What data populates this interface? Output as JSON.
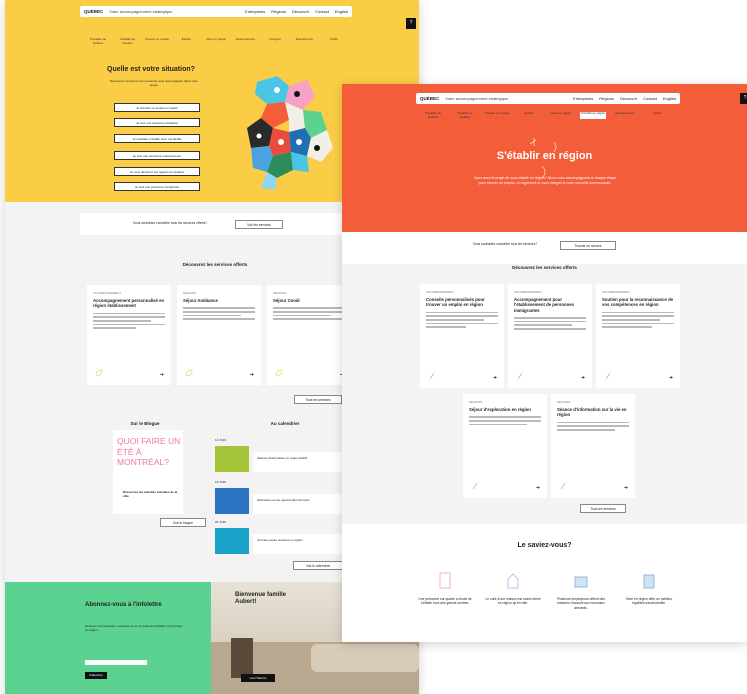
{
  "colors": {
    "yellow": "#fbcd47",
    "red": "#f45d3a",
    "green": "#5bd28f",
    "page_bg": "#f4f2f3",
    "teal": "#1aa3c9",
    "lime": "#a6c43a",
    "blue": "#2d73c4"
  },
  "page1": {
    "nav": {
      "logo": "QUÉBEC",
      "search": "Votre accompagnement stratégique",
      "links": [
        "Entreprises",
        "Régions",
        "Découvrir",
        "Contact",
        "English"
      ],
      "menu_icon": "?"
    },
    "menu": [
      "Travailler au Québec",
      "S'établir au Québec",
      "Trouver un emploi",
      "Étudier",
      "Vivre en région",
      "Entrepreneurs",
      "Immigrer",
      "Événements",
      "Outils"
    ],
    "hero_title": "Quelle est votre situation?",
    "hero_sub": "Découvrez comment nous pouvons vous accompagner dans votre projet.",
    "options": [
      "Je cherche un emploi en région",
      "Je suis une personne étudiante",
      "Je souhaite m'établir avec ma famille",
      "Je suis une personne entrepreneure",
      "Je veux découvrir les régions du Québec",
      "Je suis une personne immigrante"
    ],
    "strip_text": "Vous souhaitez connaître tous les services offerts?",
    "strip_btn": "Voir les services",
    "services_title": "Découvrez les services offerts",
    "cards": [
      {
        "cat": "ACCOMPAGNEMENT",
        "title": "Accompagnement personnalisé en région établissement"
      },
      {
        "cat": "SÉJOURS",
        "title": "Séjour Ambiance"
      },
      {
        "cat": "SÉJOURS",
        "title": "Séjour Coodi"
      }
    ],
    "all_services_btn": "Tous les services",
    "blog_title": "Sur le Blogue",
    "blog_art": "QUOI FAIRE UN ÉTÉ À MONTRÉAL?",
    "blog_caption": "Découvrez les activités estivales de la ville",
    "blog_btn": "Voir le blogue",
    "calendar_title": "Au calendrier",
    "events": [
      {
        "date": "12 JUIN",
        "text": "Séance d'information en région Abitibi"
      },
      {
        "date": "19 JUIN",
        "text": "Webinaire sur les opportunités d'emploi"
      },
      {
        "date": "26 JUIN",
        "text": "Journée portes ouvertes en région"
      }
    ],
    "calendar_btn": "Voir le calendrier",
    "newsletter_title": "Abonnez-vous à l'infolettre",
    "newsletter_text": "Recevez nos nouvelles, événements et conseils pour faciliter votre projet en région.",
    "newsletter_btn": "S'abonner",
    "photo_title": "Bienvenue famille Aubert!",
    "photo_btn": "Lire l'histoire"
  },
  "page2": {
    "nav": {
      "logo": "QUÉBEC",
      "search": "Votre accompagnement stratégique",
      "links": [
        "Entreprises",
        "Régions",
        "Découvrir",
        "Contact",
        "English"
      ],
      "menu_icon": "?"
    },
    "menu": [
      "Travailler au Québec",
      "S'établir au Québec",
      "Trouver un emploi",
      "Étudier",
      "Vivre en région",
      "S'établir en région",
      "Entrepreneurs",
      "Outils"
    ],
    "hero_title": "S'établir en région",
    "hero_text": "Vous avez le projet de vous établir en région? Nous vous accompagnons à chaque étape pour trouver un emploi, un logement et vous intégrer à votre nouvelle communauté.",
    "strip_text": "Vous souhaitez connaître tous les services?",
    "strip_btn": "Trouver un service",
    "services_title": "Découvrez les services offerts",
    "cards": [
      {
        "cat": "ACCOMPAGNEMENT",
        "title": "Conseils personnalisés pour trouver un emploi en région"
      },
      {
        "cat": "ACCOMPAGNEMENT",
        "title": "Accompagnement pour l'établissement de personnes immigrantes"
      },
      {
        "cat": "ACCOMPAGNEMENT",
        "title": "Soutien pour la reconnaissance de vos compétences en région"
      },
      {
        "cat": "SÉJOURS",
        "title": "Séjour d'exploration en région"
      },
      {
        "cat": "SÉJOURS",
        "title": "Séance d'information sur la vie en région"
      }
    ],
    "all_services_btn": "Tous les services",
    "facts_title": "Le saviez-vous?",
    "facts": [
      "Une personne sur quatre a choisi de s'établir hors des grands centres.",
      "Le coût d'une maison est moins élevé en région qu'en ville.",
      "Plusieurs employeurs offrent des mesures d'accueil aux nouveaux arrivants.",
      "Vivre en région offre un meilleur équilibre travail-famille."
    ]
  }
}
